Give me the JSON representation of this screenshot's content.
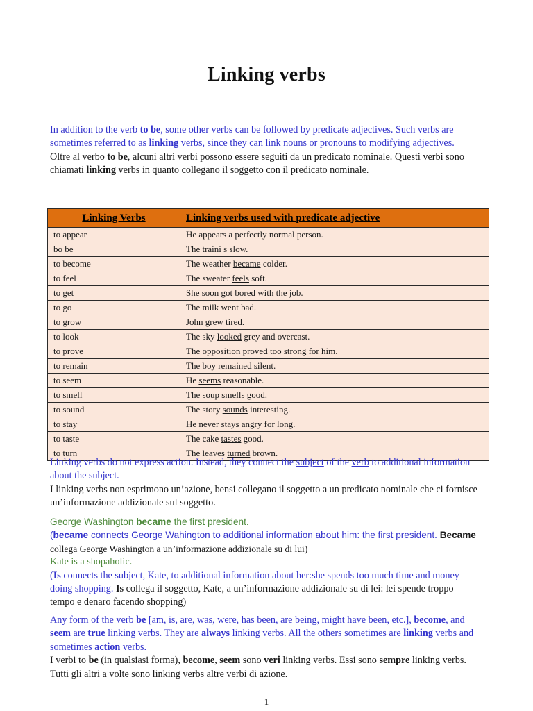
{
  "document": {
    "title": "Linking verbs",
    "page_number": "1"
  },
  "colors": {
    "header_orange": "#de6f0f",
    "cell_peach": "#fbe7db",
    "blue_text": "#3333cc",
    "green_text": "#4e8a3c",
    "black_text": "#1a1a1a"
  },
  "intro": {
    "en_line1_a": "In addition to the verb ",
    "en_line1_b": "to be",
    "en_line1_c": ", some other verbs can be followed by predicate adjectives. Such verbs are sometimes referred to as ",
    "en_line1_d": "linking",
    "en_line1_e": " verbs, since they can link nouns or pronouns to modifying adjectives.",
    "it_line_a": "Oltre al verbo ",
    "it_line_b": "to be",
    "it_line_c": ", alcuni altri verbi possono essere seguiti da un predicato nominale. Questi verbi sono chiamati ",
    "it_line_d": "linking",
    "it_line_e": " verbs in quanto collegano il soggetto con il predicato nominale."
  },
  "table": {
    "headers": {
      "verb": "Linking Verbs",
      "sentence": "Linking verbs used with predicate adjective"
    },
    "rows": [
      {
        "verb": "to appear",
        "before": "He appears a perfectly normal person.",
        "em": "",
        "after": ""
      },
      {
        "verb": "bo be",
        "before": "The traini s slow.",
        "em": "",
        "after": ""
      },
      {
        "verb": "to become",
        "before": "The weather ",
        "em": "became",
        "after": " colder."
      },
      {
        "verb": "to feel",
        "before": "The sweater ",
        "em": "feels",
        "after": " soft."
      },
      {
        "verb": "to get",
        "before": "She soon got bored with the job.",
        "em": "",
        "after": ""
      },
      {
        "verb": "to go",
        "before": "The milk went bad.",
        "em": "",
        "after": ""
      },
      {
        "verb": "to grow",
        "before": "John grew tired.",
        "em": "",
        "after": ""
      },
      {
        "verb": "to look",
        "before": "The sky ",
        "em": "looked",
        "after": " grey and overcast."
      },
      {
        "verb": "to prove",
        "before": "The opposition proved too strong for him.",
        "em": "",
        "after": ""
      },
      {
        "verb": "to remain",
        "before": "The boy remained silent.",
        "em": "",
        "after": ""
      },
      {
        "verb": "to seem",
        "before": "He ",
        "em": "seems",
        "after": " reasonable."
      },
      {
        "verb": "to smell",
        "before": "The soup ",
        "em": "smells",
        "after": " good."
      },
      {
        "verb": "to sound",
        "before": "The story ",
        "em": "sounds",
        "after": " interesting."
      },
      {
        "verb": "to stay",
        "before": "He never stays angry for long.",
        "em": "",
        "after": ""
      },
      {
        "verb": "to taste",
        "before": "The cake ",
        "em": "tastes",
        "after": " good."
      },
      {
        "verb": "to turn",
        "before": "The leaves ",
        "em": "turned",
        "after": " brown."
      }
    ]
  },
  "after_table": {
    "en_a": "Linking verbs do not express action. Instead, they connect the ",
    "en_b": "subject",
    "en_c": " of the ",
    "en_d": "verb",
    "en_e": " to additional information about the subject.",
    "it_text": "I linking verbs non esprimono un’azione, bensi collegano il soggetto a un predicato nominale che ci fornisce un’informazione addizionale sul soggetto."
  },
  "examples": {
    "ex1_green_a": "George Washington ",
    "ex1_green_b": "became",
    "ex1_green_c": " the first president.",
    "ex1_blue_a": "(",
    "ex1_blue_b": "became",
    "ex1_blue_c": " connects George Wahington to additional information about him: the first president.  ",
    "ex1_black_b": "Became",
    "ex1_black_c": " collega George Washington a un’informazione addizionale su di lui)",
    "ex2_green": "Kate is a shopaholic.",
    "ex2_blue_a": "(",
    "ex2_blue_b": "Is",
    "ex2_blue_c": " connects the subject, Kate, to additional information about her:she spends too much time and money doing shopping. ",
    "ex2_black_b": "Is",
    "ex2_black_c": " collega il soggetto, Kate, a un’informazione addizionale su di lei: lei spende troppo tempo e denaro facendo shopping)"
  },
  "summary": {
    "en_a": "Any form of the verb ",
    "en_b": "be",
    "en_c": " [am, is, are, was, were, has been, are being, might have been, etc.], ",
    "en_d": "become",
    "en_e": ", and ",
    "en_f": "seem",
    "en_g": " are ",
    "en_h": "true",
    "en_i": " linking verbs. They are ",
    "en_j": "always",
    "en_k": " linking verbs. All the others sometimes are ",
    "en_l": "linking",
    "en_m": " verbs and sometimes ",
    "en_n": "action",
    "en_o": " verbs.",
    "it_a": "I verbi to ",
    "it_b": "be",
    "it_c": " (in qualsiasi forma), ",
    "it_d": "become",
    "it_e": ", ",
    "it_f": "seem",
    "it_g": " sono ",
    "it_h": "veri",
    "it_i": " linking verbs. Essi sono ",
    "it_j": "sempre",
    "it_k": " linking verbs. Tutti gli altri a volte sono linking verbs altre verbi di azione."
  }
}
